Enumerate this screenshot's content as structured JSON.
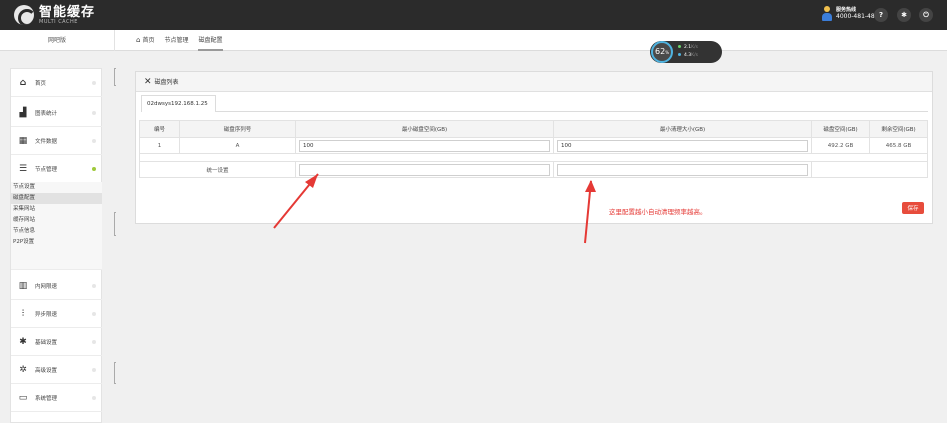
{
  "brand": {
    "name_cn": "智能缓存",
    "name_en": "MULTI CACHE"
  },
  "hotline": {
    "title": "服务热线",
    "number": "4000-481-488"
  },
  "top_buttons": [
    {
      "icon": "help-icon",
      "glyph": "?"
    },
    {
      "icon": "gear-icon",
      "glyph": "✱"
    },
    {
      "icon": "power-icon",
      "glyph": "⏻"
    }
  ],
  "subbar": {
    "left_label": "网吧版"
  },
  "tabs": [
    {
      "label": "首页",
      "icon": "home-icon"
    },
    {
      "label": "节点管理"
    },
    {
      "label": "磁盘配置",
      "active": true
    }
  ],
  "speed": {
    "percent": "62",
    "percent_unit": "%",
    "up": "2.1",
    "down": "4.3",
    "unit": "K/s",
    "up_color": "#6ad36a",
    "down_color": "#4fb3e0"
  },
  "sidebar": {
    "items": [
      {
        "label": "首页",
        "icon": "home-icon",
        "glyph": "⌂"
      },
      {
        "label": "图表统计",
        "icon": "bar-chart-icon",
        "glyph": "▟"
      },
      {
        "label": "文件数据",
        "icon": "table-icon",
        "glyph": "▦"
      },
      {
        "label": "节点管理",
        "icon": "list-icon",
        "glyph": "☰",
        "active": true
      },
      {
        "label": "内网限速",
        "icon": "barcode-icon",
        "glyph": "▥"
      },
      {
        "label": "异步限速",
        "icon": "sliders-icon",
        "glyph": "⫶"
      },
      {
        "label": "基础设置",
        "icon": "gear-icon",
        "glyph": "✱"
      },
      {
        "label": "高级设置",
        "icon": "gears-icon",
        "glyph": "✲"
      },
      {
        "label": "系统管理",
        "icon": "monitor-icon",
        "glyph": "▭"
      }
    ],
    "sub_items": [
      {
        "label": "节点设置"
      },
      {
        "label": "磁盘配置",
        "active": true
      },
      {
        "label": "采集网站"
      },
      {
        "label": "缓存网站"
      },
      {
        "label": "节点信息"
      },
      {
        "label": "P2P设置"
      }
    ]
  },
  "panel": {
    "title": "磁盘列表",
    "device_tab": "02dwsys192.168.1.25",
    "headers": [
      "编号",
      "磁盘序列号",
      "最小磁盘空间(GB)",
      "最小清理大小(GB)",
      "磁盘空间(GB)",
      "剩余空间(GB)"
    ],
    "rows": [
      {
        "id": "1",
        "serial": "A",
        "min_space": "100",
        "min_clean": "100",
        "disk_space": "492.2 GB",
        "free_space": "465.8 GB"
      }
    ],
    "unified_label": "统一设置",
    "unified_min_space": "",
    "unified_min_clean": "",
    "hint": "这里配置越小自动清理频率越高。",
    "save_label": "保存"
  },
  "colors": {
    "accent_red": "#e53935",
    "dark_bar": "#2b2b2b",
    "active_dot": "#9fc93c"
  }
}
